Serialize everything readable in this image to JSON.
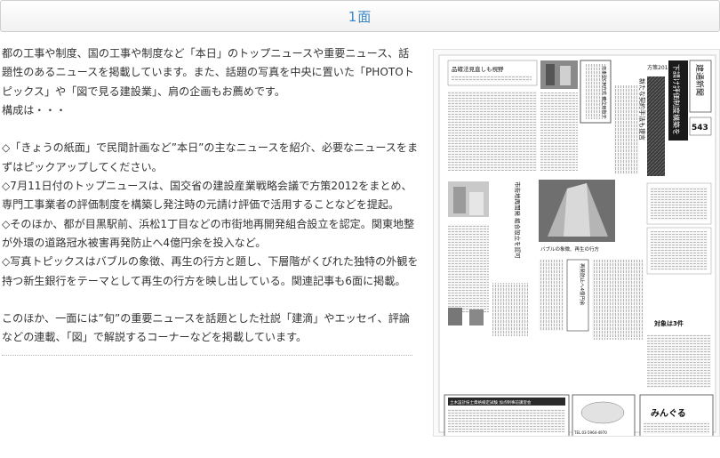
{
  "header": {
    "title": "1面"
  },
  "body": {
    "intro": "都の工事や制度、国の工事や制度など「本日」のトップニュースや重要ニュース、話題性のあるニュースを掲載しています。また、話題の写真を中央に置いた「PHOTOトピックス」や「図で見る建設業」、肩の企画もお薦めです。",
    "structure_label": "構成は・・・",
    "item1": "◇「きょうの紙面」で民間計画など”本日”の主なニュースを紹介、必要なニュースをまずはピックアップしてください。",
    "item2": "◇7月11日付のトップニュースは、国交省の建設産業戦略会議で方策2012をまとめ、専門工事業者の評価制度を構築し発注時の元請け評価で活用することなどを提起。",
    "item3": "◇そのほか、都が目黒駅前、浜松1丁目などの市街地再開発組合設立を認定。関東地整が外環の道路冠水被害再発防止へ4億円余を投入など。",
    "item4": "◇写真トピックスはバブルの象徴、再生の行方と題し、下層階がくびれた独特の外観を持つ新生銀行をテーマとして再生の行方を映し出している。関連記事も6面に掲載。",
    "outro": "このほか、一面には”旬”の重要ニュースを話題とした社説「建滴」やエッセイ、評論などの連載、「図」で解説するコーナーなどを掲載しています。"
  },
  "newspaper": {
    "masthead": "建通新聞",
    "headline_main": "下請け評価制度構築を",
    "headline_sub": "新たな契約手法も提言",
    "headline_left": "品確法見直しも視野",
    "headline_cm": "日本型CM方式 確立目指す",
    "headline_vertical": "市街地再開発 組合設立を認可",
    "headline_flood": "再発防止へ4億円余",
    "photo_caption": "バブルの象徴、再生の行方",
    "corner_label": "方策2012",
    "ad_left_title": "土木設計技士資格検定試験 加点制事前講習会",
    "ad_right_title": "みんぐる",
    "ad_phone": "TEL.03-5964-4970",
    "side_number": "543",
    "side_heading": "対象は3件"
  }
}
